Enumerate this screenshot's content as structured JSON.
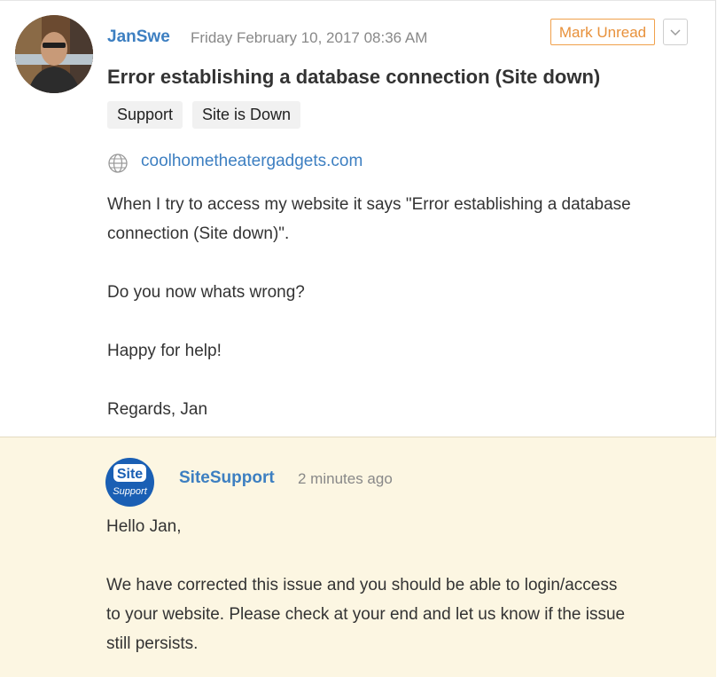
{
  "ticket": {
    "author": "JanSwe",
    "date": "Friday February 10, 2017 08:36 AM",
    "mark_unread_label": "Mark Unread",
    "title": "Error establishing a database connection (Site down)",
    "tags": [
      "Support",
      "Site is Down"
    ],
    "website": "coolhometheatergadgets.com",
    "body": [
      "When I try to access my website it says \"Error establishing a database",
      "connection (Site down)\".",
      "Do you now whats wrong?",
      "Happy for help!",
      "Regards, Jan"
    ]
  },
  "reply": {
    "logo_text_top": "Site",
    "logo_text_bottom": "Support",
    "author": "SiteSupport",
    "time": "2 minutes ago",
    "body": [
      "Hello Jan,",
      "We have corrected this issue and you should be able to login/access",
      "to your website. Please check at your end and let us know if the issue",
      "still persists."
    ]
  },
  "colors": {
    "link": "#3d7fc1",
    "mark_unread": "#e8913b",
    "reply_background": "#fcf6e2",
    "support_logo": "#1a5fb4"
  },
  "icons": [
    "globe-icon",
    "chevron-down-icon"
  ]
}
